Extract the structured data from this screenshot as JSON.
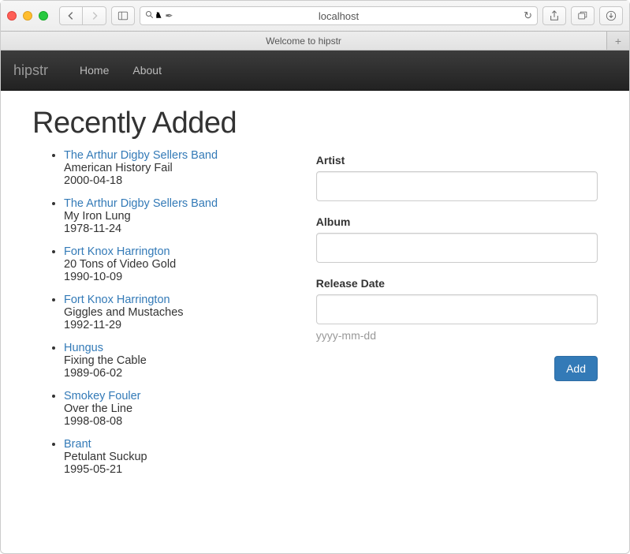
{
  "browser": {
    "url": "localhost",
    "tab_title": "Welcome to hipstr"
  },
  "navbar": {
    "brand": "hipstr",
    "links": [
      "Home",
      "About"
    ]
  },
  "page_title": "Recently Added",
  "albums": [
    {
      "artist": "The Arthur Digby Sellers Band",
      "album": "American History Fail",
      "date": "2000-04-18"
    },
    {
      "artist": "The Arthur Digby Sellers Band",
      "album": "My Iron Lung",
      "date": "1978-11-24"
    },
    {
      "artist": "Fort Knox Harrington",
      "album": "20 Tons of Video Gold",
      "date": "1990-10-09"
    },
    {
      "artist": "Fort Knox Harrington",
      "album": "Giggles and Mustaches",
      "date": "1992-11-29"
    },
    {
      "artist": "Hungus",
      "album": "Fixing the Cable",
      "date": "1989-06-02"
    },
    {
      "artist": "Smokey Fouler",
      "album": "Over the Line",
      "date": "1998-08-08"
    },
    {
      "artist": "Brant",
      "album": "Petulant Suckup",
      "date": "1995-05-21"
    }
  ],
  "form": {
    "artist_label": "Artist",
    "album_label": "Album",
    "release_label": "Release Date",
    "release_help": "yyyy-mm-dd",
    "submit_label": "Add"
  }
}
